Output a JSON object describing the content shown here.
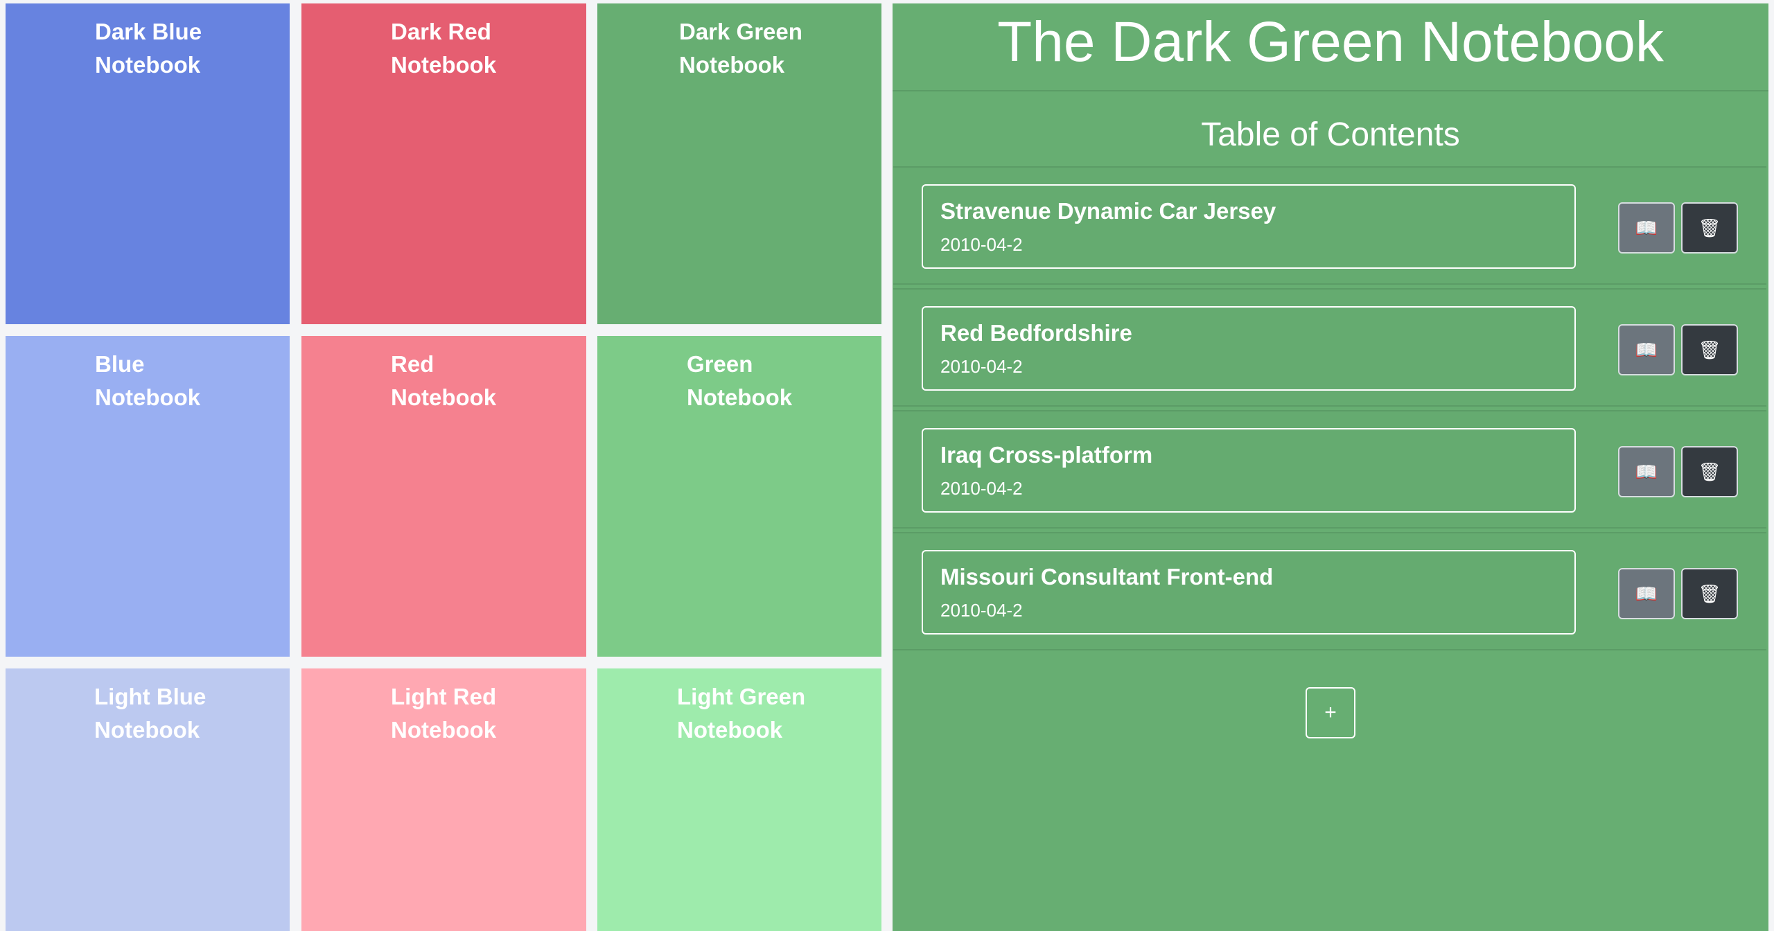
{
  "notebooks": [
    {
      "label": "Dark Blue\nNotebook",
      "color": "#6783e0"
    },
    {
      "label": "Dark Red\nNotebook",
      "color": "#e55e71"
    },
    {
      "label": "Dark Green\nNotebook",
      "color": "#67ae72"
    },
    {
      "label": "Blue\nNotebook",
      "color": "#99aff2"
    },
    {
      "label": "Red\nNotebook",
      "color": "#f5818f"
    },
    {
      "label": "Green\nNotebook",
      "color": "#7dcb88"
    },
    {
      "label": "Light Blue\nNotebook",
      "color": "#bcc9f0"
    },
    {
      "label": "Light Red\nNotebook",
      "color": "#ffa8b2"
    },
    {
      "label": "Light Green\nNotebook",
      "color": "#9eebac"
    }
  ],
  "panel": {
    "title": "The Dark Green Notebook",
    "toc_title": "Table of Contents",
    "entries": [
      {
        "title": "Stravenue Dynamic Car Jersey",
        "date": "2010-04-2"
      },
      {
        "title": "Red Bedfordshire",
        "date": "2010-04-2"
      },
      {
        "title": "Iraq Cross-platform",
        "date": "2010-04-2"
      },
      {
        "title": "Missouri Consultant Front-end",
        "date": "2010-04-2"
      }
    ],
    "open_icon": "book-icon",
    "open_glyph": "📖",
    "delete_icon": "wastebasket-icon",
    "delete_glyph": "🗑",
    "add_label": "+"
  }
}
